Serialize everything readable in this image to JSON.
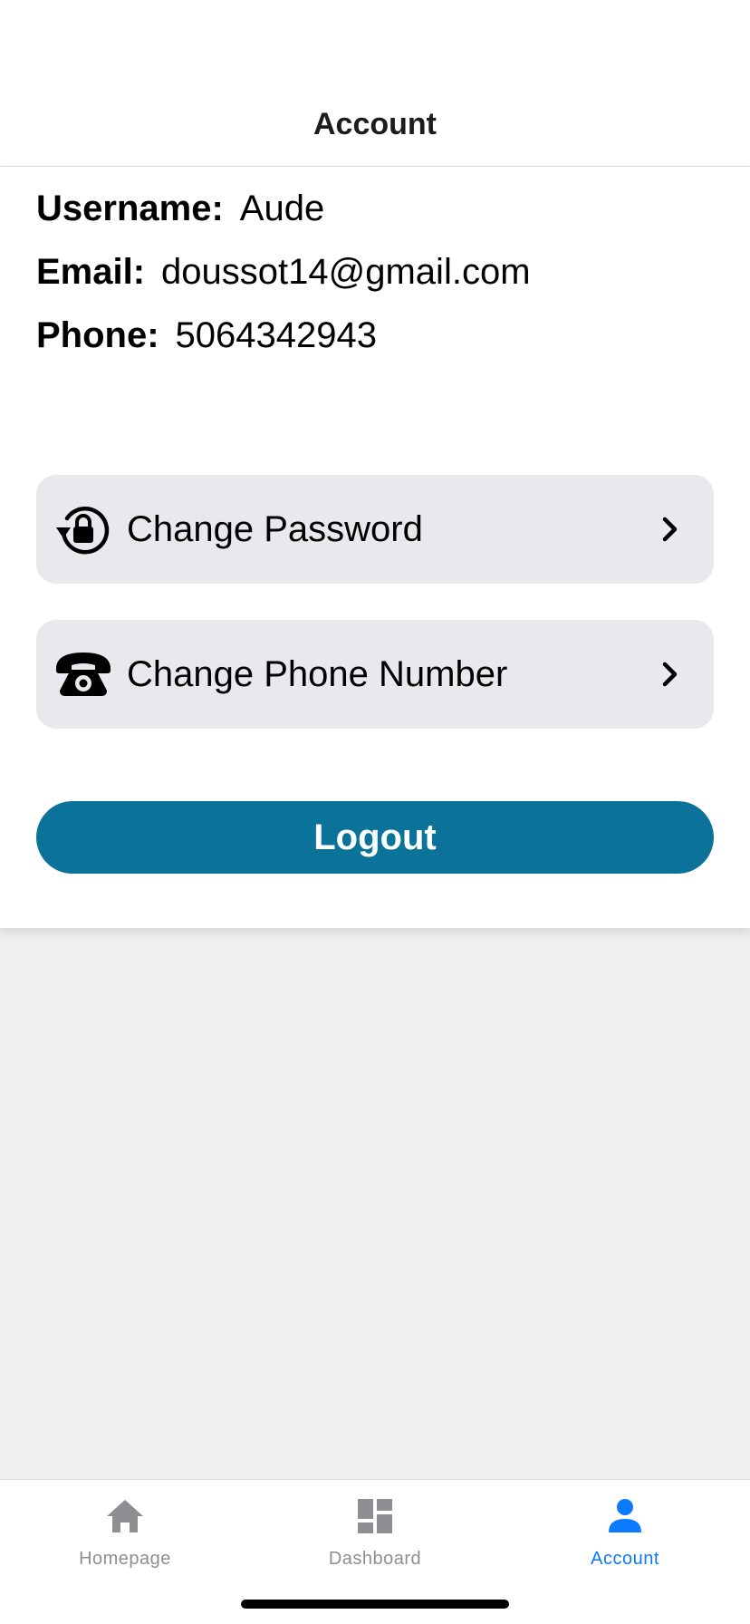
{
  "header": {
    "title": "Account"
  },
  "profile": {
    "username_label": "Username:",
    "username_value": "Aude",
    "email_label": "Email:",
    "email_value": "doussot14@gmail.com",
    "phone_label": "Phone:",
    "phone_value": "5064342943"
  },
  "actions": [
    {
      "label": "Change Password",
      "icon": "lock-reset-icon"
    },
    {
      "label": "Change Phone Number",
      "icon": "telephone-icon"
    }
  ],
  "logout": {
    "label": "Logout",
    "color": "#0b7399"
  },
  "tabbar": {
    "items": [
      {
        "label": "Homepage",
        "icon": "home-icon",
        "active": false
      },
      {
        "label": "Dashboard",
        "icon": "dashboard-icon",
        "active": false
      },
      {
        "label": "Account",
        "icon": "person-icon",
        "active": true
      }
    ],
    "active_color": "#0a7aff",
    "inactive_color": "#8e8e93"
  }
}
